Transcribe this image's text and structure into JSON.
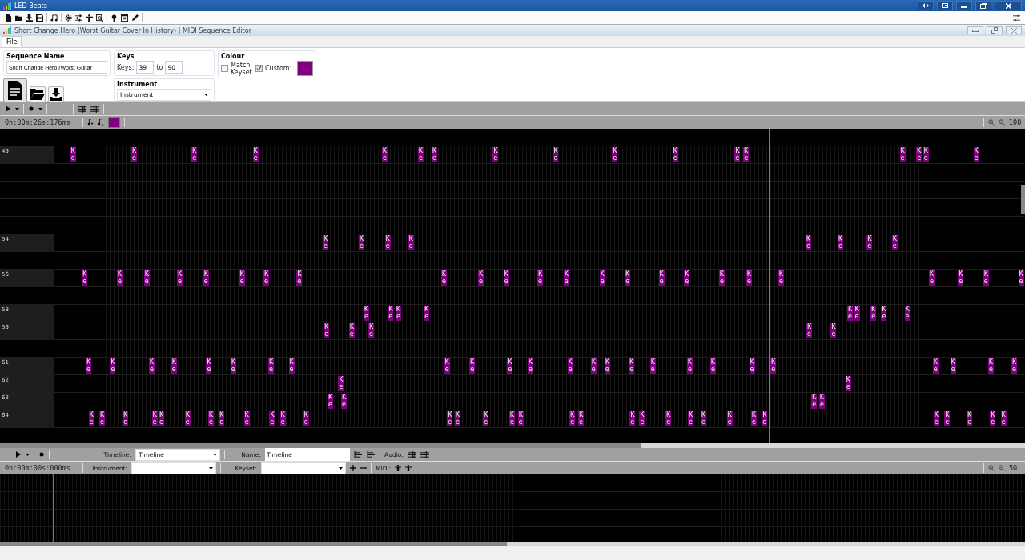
{
  "window": {
    "title": "LED Beats"
  },
  "document": {
    "title": "Short Change Hero (Worst Guitar Cover In History) | MIDI Sequence Editor"
  },
  "tabs": [
    {
      "label": "File",
      "selected": true
    }
  ],
  "sequence_name": {
    "heading": "Sequence Name",
    "value": "Short Change Hero (Worst Guitar"
  },
  "keys": {
    "heading": "Keys",
    "label": "Keys:",
    "from": "39",
    "to_label": "to",
    "to": "90"
  },
  "instrument": {
    "heading": "Instrument",
    "value": "Instrument"
  },
  "colour": {
    "heading": "Colour",
    "options": [
      {
        "label": "Match Keyset",
        "checked": false
      },
      {
        "label": "Custom:",
        "checked": true
      }
    ],
    "color": "#800080"
  },
  "editor": {
    "time": "0h:00m:26s:176ms",
    "swatch": {
      "color": "#800080"
    },
    "zoom": "100",
    "playhead": {
      "level": 0.737
    },
    "rows": [
      {
        "label": "49",
        "notes": [
          {
            "level": 0.017,
            "label": "Ke"
          },
          {
            "level": 0.08,
            "label": "Ke"
          },
          {
            "level": 0.142,
            "label": "Ke"
          },
          {
            "level": 0.205,
            "label": "Ke"
          },
          {
            "level": 0.338,
            "label": "Ke"
          },
          {
            "level": 0.375,
            "label": "Ke"
          },
          {
            "level": 0.389,
            "label": "Ke"
          },
          {
            "level": 0.452,
            "label": "Ke"
          },
          {
            "level": 0.514,
            "label": "Ke"
          },
          {
            "level": 0.575,
            "label": "Ke"
          },
          {
            "level": 0.637,
            "label": "Ke"
          },
          {
            "level": 0.701,
            "label": "Ke"
          },
          {
            "level": 0.71,
            "label": "Ke"
          },
          {
            "level": 0.871,
            "label": "Ke"
          },
          {
            "level": 0.888,
            "label": "Ke"
          },
          {
            "level": 0.895,
            "label": "Ke"
          },
          {
            "level": 0.947,
            "label": "Ke"
          }
        ]
      },
      {},
      {},
      {},
      {},
      {
        "label": "54",
        "notes": [
          {
            "level": 0.277,
            "label": "Ke"
          },
          {
            "level": 0.314,
            "label": "Ke"
          },
          {
            "level": 0.341,
            "label": "Ke"
          },
          {
            "level": 0.365,
            "label": "Ke"
          },
          {
            "level": 0.774,
            "label": "Ke"
          },
          {
            "level": 0.807,
            "label": "Ke"
          },
          {
            "level": 0.837,
            "label": "Ke"
          },
          {
            "level": 0.863,
            "label": "Ke"
          }
        ]
      },
      {},
      {
        "label": "56",
        "notes": [
          {
            "level": 0.029,
            "label": "Ke"
          },
          {
            "level": 0.065,
            "label": "Ke"
          },
          {
            "level": 0.093,
            "label": "Ke"
          },
          {
            "level": 0.127,
            "label": "Ke"
          },
          {
            "level": 0.154,
            "label": "Ke"
          },
          {
            "level": 0.191,
            "label": "Ke"
          },
          {
            "level": 0.216,
            "label": "Ke"
          },
          {
            "level": 0.25,
            "label": "Ke"
          },
          {
            "level": 0.399,
            "label": "Ke"
          },
          {
            "level": 0.437,
            "label": "Ke"
          },
          {
            "level": 0.463,
            "label": "Ke"
          },
          {
            "level": 0.498,
            "label": "Ke"
          },
          {
            "level": 0.525,
            "label": "Ke"
          },
          {
            "level": 0.562,
            "label": "Ke"
          },
          {
            "level": 0.588,
            "label": "Ke"
          },
          {
            "level": 0.623,
            "label": "Ke"
          },
          {
            "level": 0.649,
            "label": "Ke"
          },
          {
            "level": 0.685,
            "label": "Ke"
          },
          {
            "level": 0.713,
            "label": "Ke"
          },
          {
            "level": 0.746,
            "label": "Ke"
          },
          {
            "level": 0.901,
            "label": "Ke"
          },
          {
            "level": 0.931,
            "label": "Ke"
          },
          {
            "level": 0.957,
            "label": "Ke"
          },
          {
            "level": 0.993,
            "label": "Ke"
          }
        ]
      },
      {},
      {
        "label": "58",
        "notes": [
          {
            "level": 0.319,
            "label": "Ke"
          },
          {
            "level": 0.344,
            "label": "Ke"
          },
          {
            "level": 0.352,
            "label": "Ke"
          },
          {
            "level": 0.381,
            "label": "Ke"
          },
          {
            "level": 0.817,
            "label": "Ke"
          },
          {
            "level": 0.824,
            "label": "Ke"
          },
          {
            "level": 0.841,
            "label": "Ke"
          },
          {
            "level": 0.852,
            "label": "Ke"
          },
          {
            "level": 0.876,
            "label": "Ke"
          }
        ]
      },
      {
        "label": "59",
        "notes": [
          {
            "level": 0.278,
            "label": "Ke"
          },
          {
            "level": 0.304,
            "label": "Ke"
          },
          {
            "level": 0.324,
            "label": "Ke"
          },
          {
            "level": 0.775,
            "label": "Ke"
          },
          {
            "level": 0.8,
            "label": "Ke"
          }
        ]
      },
      {},
      {
        "label": "61",
        "notes": [
          {
            "level": 0.033,
            "label": "Ke"
          },
          {
            "level": 0.058,
            "label": "Ke"
          },
          {
            "level": 0.098,
            "label": "Ke"
          },
          {
            "level": 0.121,
            "label": "Ke"
          },
          {
            "level": 0.157,
            "label": "Ke"
          },
          {
            "level": 0.182,
            "label": "Ke"
          },
          {
            "level": 0.221,
            "label": "Ke"
          },
          {
            "level": 0.242,
            "label": "Ke"
          },
          {
            "level": 0.402,
            "label": "Ke"
          },
          {
            "level": 0.428,
            "label": "Ke"
          },
          {
            "level": 0.467,
            "label": "Ke"
          },
          {
            "level": 0.488,
            "label": "Ke"
          },
          {
            "level": 0.529,
            "label": "Ke"
          },
          {
            "level": 0.553,
            "label": "Ke"
          },
          {
            "level": 0.567,
            "label": "Ke"
          },
          {
            "level": 0.592,
            "label": "Ke"
          },
          {
            "level": 0.614,
            "label": "Ke"
          },
          {
            "level": 0.652,
            "label": "Ke"
          },
          {
            "level": 0.676,
            "label": "Ke"
          },
          {
            "level": 0.716,
            "label": "Ke"
          },
          {
            "level": 0.738,
            "label": "Ke"
          },
          {
            "level": 0.905,
            "label": "Ke"
          },
          {
            "level": 0.923,
            "label": "Ke"
          },
          {
            "level": 0.962,
            "label": "Ke"
          },
          {
            "level": 0.986,
            "label": "Ke"
          }
        ]
      },
      {
        "label": "62",
        "notes": [
          {
            "level": 0.293,
            "label": "Ke"
          },
          {
            "level": 0.815,
            "label": "Ke"
          }
        ]
      },
      {
        "label": "63",
        "notes": [
          {
            "level": 0.282,
            "label": "Ke"
          },
          {
            "level": 0.296,
            "label": "Ke"
          },
          {
            "level": 0.78,
            "label": "Ke"
          },
          {
            "level": 0.788,
            "label": "Ke"
          }
        ]
      },
      {
        "label": "64",
        "notes": [
          {
            "level": 0.036,
            "label": "Ke"
          },
          {
            "level": 0.047,
            "label": "Ke"
          },
          {
            "level": 0.071,
            "label": "Ke"
          },
          {
            "level": 0.101,
            "label": "Ke"
          },
          {
            "level": 0.108,
            "label": "Ke"
          },
          {
            "level": 0.135,
            "label": "Ke"
          },
          {
            "level": 0.159,
            "label": "Ke"
          },
          {
            "level": 0.17,
            "label": "Ke"
          },
          {
            "level": 0.196,
            "label": "Ke"
          },
          {
            "level": 0.222,
            "label": "Ke"
          },
          {
            "level": 0.233,
            "label": "Ke"
          },
          {
            "level": 0.257,
            "label": "Ke"
          },
          {
            "level": 0.405,
            "label": "Ke"
          },
          {
            "level": 0.413,
            "label": "Ke"
          },
          {
            "level": 0.442,
            "label": "Ke"
          },
          {
            "level": 0.469,
            "label": "Ke"
          },
          {
            "level": 0.478,
            "label": "Ke"
          },
          {
            "level": 0.531,
            "label": "Ke"
          },
          {
            "level": 0.54,
            "label": "Ke"
          },
          {
            "level": 0.593,
            "label": "Ke"
          },
          {
            "level": 0.603,
            "label": "Ke"
          },
          {
            "level": 0.63,
            "label": "Ke"
          },
          {
            "level": 0.653,
            "label": "Ke"
          },
          {
            "level": 0.666,
            "label": "Ke"
          },
          {
            "level": 0.693,
            "label": "Ke"
          },
          {
            "level": 0.718,
            "label": "Ke"
          },
          {
            "level": 0.729,
            "label": "Ke"
          },
          {
            "level": 0.906,
            "label": "Ke"
          },
          {
            "level": 0.917,
            "label": "Ke"
          },
          {
            "level": 0.94,
            "label": "Ke"
          },
          {
            "level": 0.964,
            "label": "Ke"
          },
          {
            "level": 0.975,
            "label": "Ke"
          }
        ]
      }
    ]
  },
  "timeline": {
    "time": "0h:00m:00s:000ms",
    "timeline_label": "Timeline:",
    "timeline_value": "Timeline",
    "name_label": "Name:",
    "name_value": "Timeline",
    "audio_label": "Audio:",
    "instrument_label": "Instrument:",
    "keyset_label": "Keyset:",
    "midi_label": "MIDI:",
    "zoom": "50",
    "playhead": {
      "level": 0
    }
  }
}
